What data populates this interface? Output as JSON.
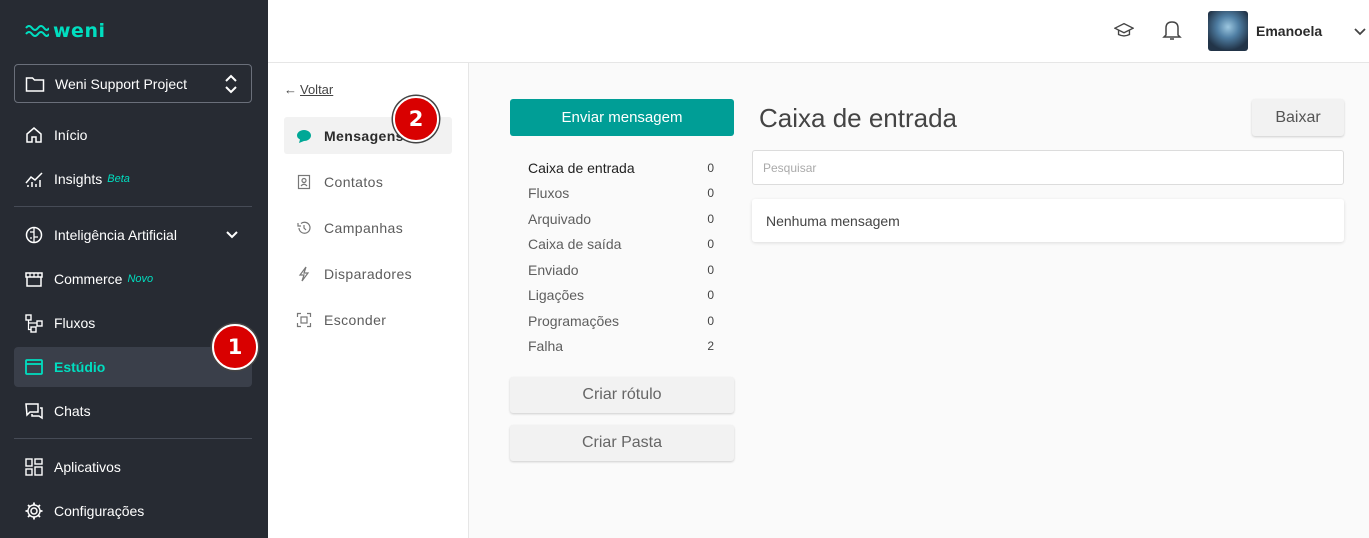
{
  "brand": {
    "logo_text": "weni",
    "accent": "#00dec0"
  },
  "sidebar": {
    "project": "Weni Support Project",
    "items": [
      {
        "label": "Início",
        "icon": "home-icon"
      },
      {
        "label": "Insights",
        "tag": "Beta",
        "icon": "chart-line-icon"
      },
      {
        "label": "Inteligência Artificial",
        "icon": "brain-icon"
      },
      {
        "label": "Commerce",
        "tag": "Novo",
        "icon": "store-icon"
      },
      {
        "label": "Fluxos",
        "icon": "flow-icon"
      },
      {
        "label": "Estúdio",
        "icon": "studio-icon",
        "active": true
      },
      {
        "label": "Chats",
        "icon": "chats-icon"
      },
      {
        "label": "Aplicativos",
        "icon": "apps-icon"
      },
      {
        "label": "Configurações",
        "icon": "gear-icon"
      }
    ]
  },
  "header": {
    "user_name": "Emanoela"
  },
  "subnav": {
    "back_arrow": "←",
    "back_label": "Voltar",
    "items": [
      {
        "label": "Mensagens",
        "active": true
      },
      {
        "label": "Contatos"
      },
      {
        "label": "Campanhas"
      },
      {
        "label": "Disparadores"
      },
      {
        "label": "Esconder"
      }
    ]
  },
  "annotations": {
    "badge1": "1",
    "badge2": "2"
  },
  "messages": {
    "send_label": "Enviar mensagem",
    "folders": [
      {
        "name": "Caixa de entrada",
        "count": "0"
      },
      {
        "name": "Fluxos",
        "count": "0"
      },
      {
        "name": "Arquivado",
        "count": "0"
      },
      {
        "name": "Caixa de saída",
        "count": "0"
      },
      {
        "name": "Enviado",
        "count": "0"
      },
      {
        "name": "Ligações",
        "count": "0"
      },
      {
        "name": "Programações",
        "count": "0"
      },
      {
        "name": "Falha",
        "count": "2"
      }
    ],
    "create_label_btn": "Criar rótulo",
    "create_folder_btn": "Criar Pasta",
    "title": "Caixa de entrada",
    "download_btn": "Baixar",
    "search_placeholder": "Pesquisar",
    "empty_text": "Nenhuma mensagem"
  }
}
